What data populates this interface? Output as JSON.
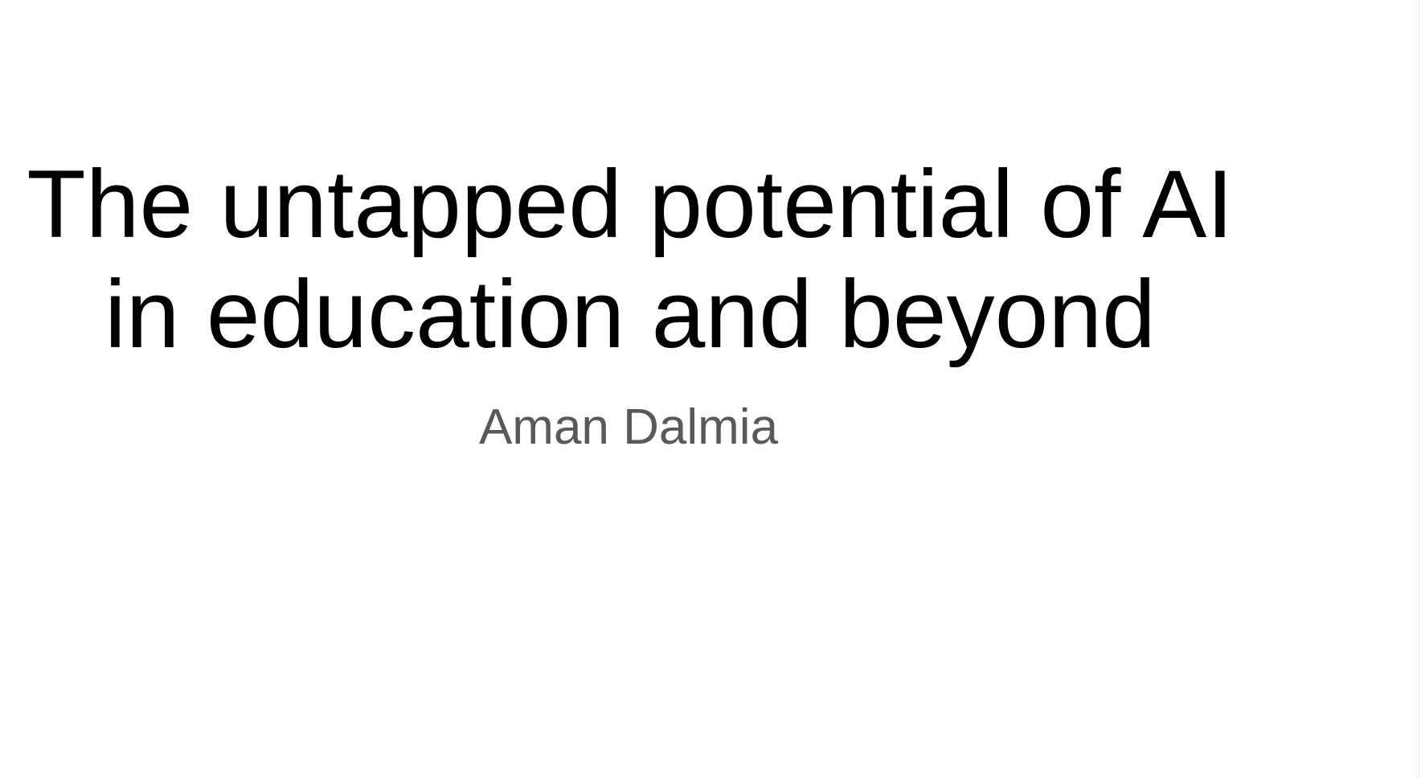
{
  "slide": {
    "title_lines": [
      "The untapped potential of AI",
      "in education and beyond"
    ],
    "subtitle": "Aman Dalmia",
    "colors": {
      "background": "#ffffff",
      "title": "#000000",
      "subtitle": "#595959"
    }
  }
}
